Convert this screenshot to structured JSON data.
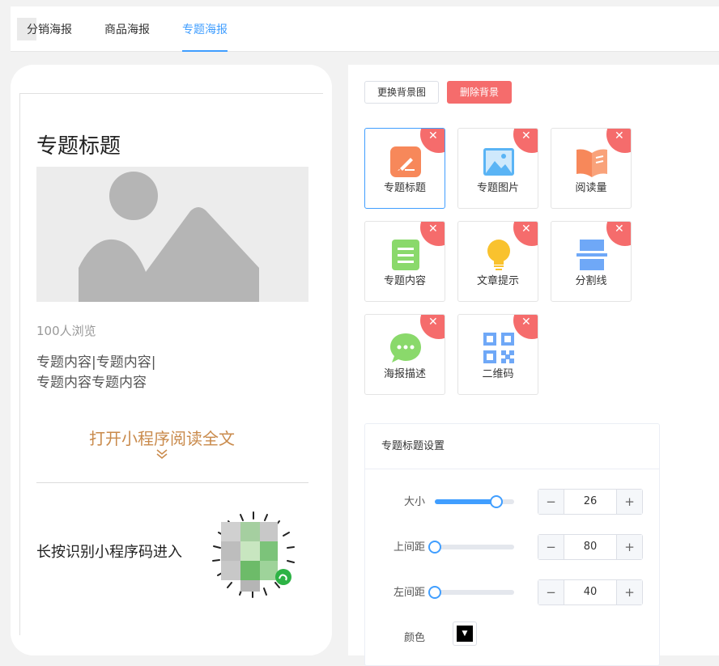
{
  "tabs": [
    {
      "label": "分销海报",
      "active": false
    },
    {
      "label": "商品海报",
      "active": false
    },
    {
      "label": "专题海报",
      "active": true
    }
  ],
  "preview": {
    "title": "专题标题",
    "views": "100人浏览",
    "content_line1": "专题内容|专题内容|",
    "content_line2": "专题内容专题内容",
    "open_text": "打开小程序阅读全文",
    "scan_text": "长按识别小程序码进入"
  },
  "toolbar": {
    "change_bg": "更换背景图",
    "delete_bg": "删除背景"
  },
  "components": [
    {
      "label": "专题标题",
      "icon": "edit-icon",
      "color": "#f7885a"
    },
    {
      "label": "专题图片",
      "icon": "image-icon",
      "color": "#5ab4f5"
    },
    {
      "label": "阅读量",
      "icon": "book-icon",
      "color": "#f7885a"
    },
    {
      "label": "专题内容",
      "icon": "document-icon",
      "color": "#8ad96b"
    },
    {
      "label": "文章提示",
      "icon": "lightbulb-icon",
      "color": "#f9c22e"
    },
    {
      "label": "分割线",
      "icon": "divider-icon",
      "color": "#6fa8f7"
    },
    {
      "label": "海报描述",
      "icon": "chat-icon",
      "color": "#8ad96b"
    },
    {
      "label": "二维码",
      "icon": "qrcode-icon",
      "color": "#6fa8f7"
    }
  ],
  "settings": {
    "title": "专题标题设置",
    "size": {
      "label": "大小",
      "value": "26",
      "slider_fraction": 0.78
    },
    "top_margin": {
      "label": "上间距",
      "value": "80",
      "slider_fraction": 0.0
    },
    "left_margin": {
      "label": "左间距",
      "value": "40",
      "slider_fraction": 0.0
    },
    "color": {
      "label": "颜色",
      "value": "#000000"
    }
  },
  "colors": {
    "accent": "#409eff",
    "danger": "#f56c6c",
    "open_text": "#c98a4b"
  }
}
